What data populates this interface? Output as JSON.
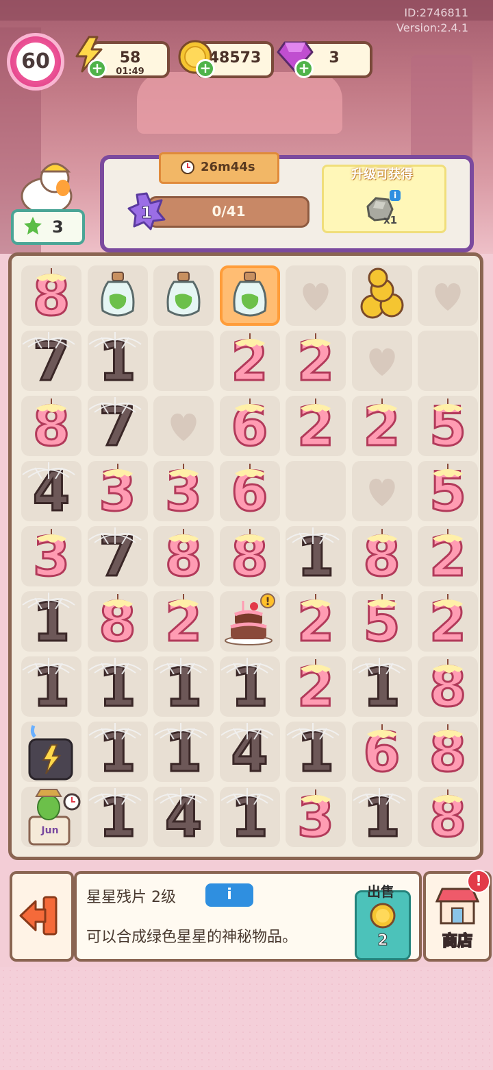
{
  "meta": {
    "id_text": "ID:2746811",
    "version_text": "Version:2.4.1"
  },
  "hud": {
    "level": "60",
    "energy": {
      "value": "58",
      "timer": "01:49"
    },
    "coins": {
      "value": "48573"
    },
    "gems": {
      "value": "3"
    }
  },
  "duck": {
    "count": "3"
  },
  "task": {
    "timer": "26m44s",
    "star_level": "1",
    "progress_text": "0/41",
    "reward_title": "升级可获得",
    "reward_qty": "x1",
    "reward_item": "rock-icon"
  },
  "board": {
    "rows": [
      [
        "p8",
        "bottle-blob",
        "bottle-bulb",
        "bottle-tall-selected",
        "heart",
        "coins",
        "heart"
      ],
      [
        "w7",
        "w1",
        "empty",
        "p2",
        "p2",
        "heart",
        "empty"
      ],
      [
        "p8",
        "w7",
        "heart",
        "p6",
        "p2",
        "p2",
        "p5"
      ],
      [
        "w4",
        "p3",
        "p3",
        "p6",
        "empty",
        "heart",
        "p5"
      ],
      [
        "p3",
        "w7",
        "p8",
        "p8",
        "w1",
        "p8",
        "p2"
      ],
      [
        "w1",
        "p8",
        "p2",
        "cake",
        "p2",
        "p5",
        "p2"
      ],
      [
        "w1",
        "w1",
        "w1",
        "w1",
        "p2",
        "w1",
        "p8"
      ],
      [
        "generator-bolt",
        "w1",
        "w1",
        "w4",
        "w1",
        "p6",
        "p8"
      ],
      [
        "cactus-pot",
        "w1",
        "w4",
        "w1",
        "p3",
        "w1",
        "p8"
      ]
    ],
    "cactus_label": "Jun"
  },
  "bottom": {
    "item_name": "星星残片 2级",
    "info_btn": "i",
    "item_desc": "可以合成绿色星星的神秘物品。",
    "sell_label": "出售",
    "sell_value": "2",
    "shop_label": "商店",
    "shop_alert": "!"
  },
  "colors": {
    "board_border": "#8a6552",
    "panel_purple": "#7b4a9e",
    "teal": "#4cc2ba",
    "candle_pink": "#ff9cb3"
  }
}
